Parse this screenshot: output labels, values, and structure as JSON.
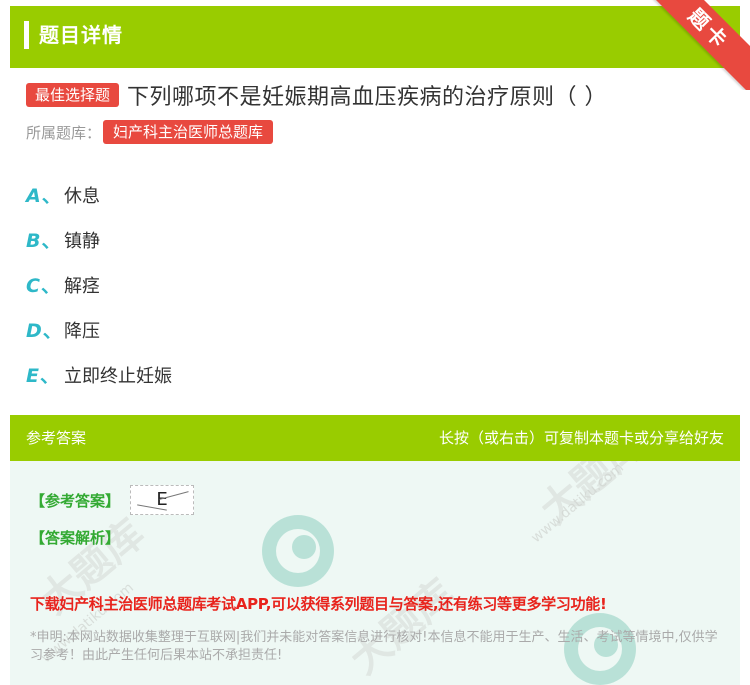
{
  "header": {
    "title": "题目详情",
    "ribbon": "题卡"
  },
  "question": {
    "type_badge": "最佳选择题",
    "text": "下列哪项不是妊娠期高血压疾病的治疗原则（ ）",
    "source_label": "所属题库：",
    "source_badge": "妇产科主治医师总题库"
  },
  "options": [
    {
      "letter": "A",
      "sep": "、",
      "text": "休息"
    },
    {
      "letter": "B",
      "sep": "、",
      "text": "镇静"
    },
    {
      "letter": "C",
      "sep": "、",
      "text": "解痉"
    },
    {
      "letter": "D",
      "sep": "、",
      "text": "降压"
    },
    {
      "letter": "E",
      "sep": "、",
      "text": "立即终止妊娠"
    }
  ],
  "answer_panel": {
    "label": "参考答案",
    "hint": "长按（或右击）可复制本题卡或分享给好友",
    "ref_tag": "【参考答案】",
    "answer_value": "E",
    "analysis_tag": "【答案解析】",
    "promo": "下载妇产科主治医师总题库考试APP,可以获得系列题目与答案,还有练习等更多学习功能!",
    "disclaimer": "*申明:本网站数据收集整理于互联网|我们并未能对答案信息进行核对!本信息不能用于生产、生活、考试等情境中,仅供学习参考！由此产生任何后果本站不承担责任!"
  },
  "watermark": {
    "brand": "大题库",
    "url": "www.datiku.com"
  },
  "colors": {
    "green": "#99cc00",
    "red": "#e8493f",
    "teal": "#2eb8c8"
  }
}
